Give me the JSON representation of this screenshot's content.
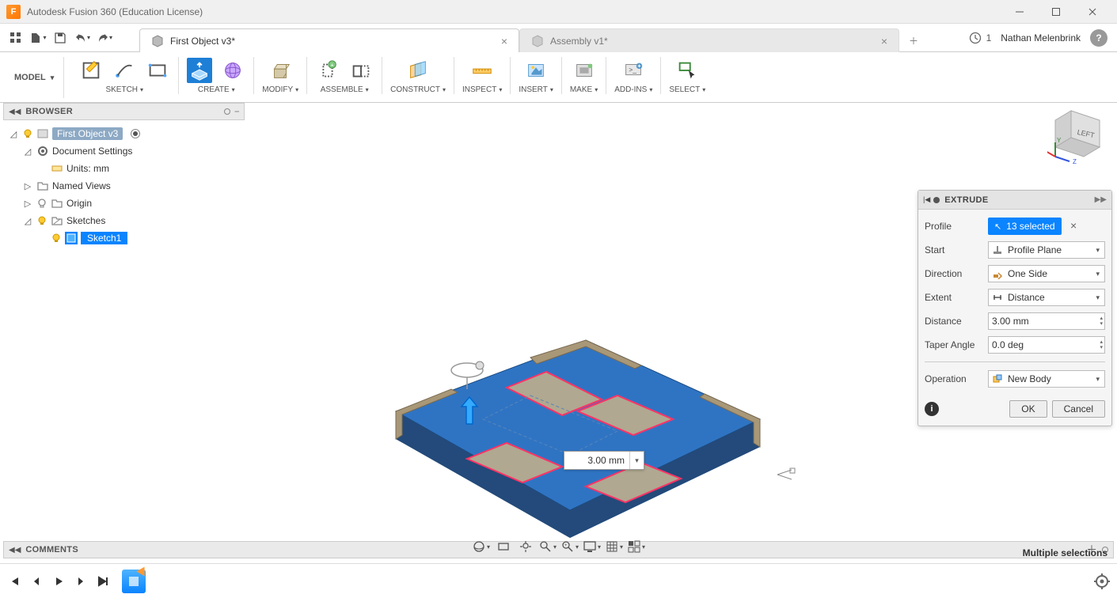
{
  "titlebar": {
    "app_icon_letter": "F",
    "title": "Autodesk Fusion 360 (Education License)"
  },
  "qat": {
    "job_count": "1",
    "user_name": "Nathan Melenbrink"
  },
  "tabs": [
    {
      "label": "First Object v3*",
      "active": true
    },
    {
      "label": "Assembly v1*",
      "active": false
    }
  ],
  "workspace": {
    "label": "MODEL"
  },
  "ribbon_groups": [
    {
      "label": "SKETCH"
    },
    {
      "label": "CREATE"
    },
    {
      "label": "MODIFY"
    },
    {
      "label": "ASSEMBLE"
    },
    {
      "label": "CONSTRUCT"
    },
    {
      "label": "INSPECT"
    },
    {
      "label": "INSERT"
    },
    {
      "label": "MAKE"
    },
    {
      "label": "ADD-INS"
    },
    {
      "label": "SELECT"
    }
  ],
  "browser": {
    "title": "BROWSER",
    "root": "First Object v3",
    "items": {
      "doc_settings": "Document Settings",
      "units": "Units: mm",
      "named_views": "Named Views",
      "origin": "Origin",
      "sketches": "Sketches",
      "sketch1": "Sketch1"
    }
  },
  "viewcube": {
    "face": "LEFT"
  },
  "dim_input": {
    "value": "3.00 mm"
  },
  "extrude": {
    "title": "EXTRUDE",
    "rows": {
      "profile_label": "Profile",
      "profile_value": "13 selected",
      "start_label": "Start",
      "start_value": "Profile Plane",
      "direction_label": "Direction",
      "direction_value": "One Side",
      "extent_label": "Extent",
      "extent_value": "Distance",
      "distance_label": "Distance",
      "distance_value": "3.00 mm",
      "taper_label": "Taper Angle",
      "taper_value": "0.0 deg",
      "operation_label": "Operation",
      "operation_value": "New Body"
    },
    "buttons": {
      "ok": "OK",
      "cancel": "Cancel"
    }
  },
  "comments": {
    "title": "COMMENTS"
  },
  "status": {
    "text": "Multiple selections"
  }
}
